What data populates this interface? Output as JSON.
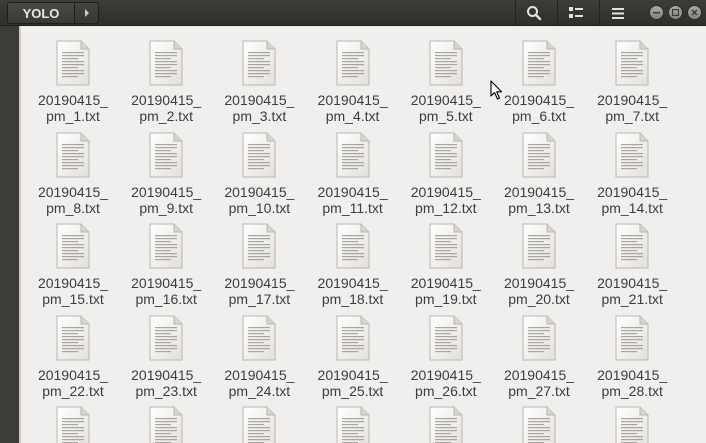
{
  "header": {
    "folder": "YOLO",
    "icons": [
      "chevron-right-icon",
      "search-icon",
      "view-toggle-icon",
      "menu-icon",
      "minimize-icon",
      "maximize-icon",
      "close-icon"
    ]
  },
  "files": [
    "20190415_\npm_1.txt",
    "20190415_\npm_2.txt",
    "20190415_\npm_3.txt",
    "20190415_\npm_4.txt",
    "20190415_\npm_5.txt",
    "20190415_\npm_6.txt",
    "20190415_\npm_7.txt",
    "20190415_\npm_8.txt",
    "20190415_\npm_9.txt",
    "20190415_\npm_10.txt",
    "20190415_\npm_11.txt",
    "20190415_\npm_12.txt",
    "20190415_\npm_13.txt",
    "20190415_\npm_14.txt",
    "20190415_\npm_15.txt",
    "20190415_\npm_16.txt",
    "20190415_\npm_17.txt",
    "20190415_\npm_18.txt",
    "20190415_\npm_19.txt",
    "20190415_\npm_20.txt",
    "20190415_\npm_21.txt",
    "20190415_\npm_22.txt",
    "20190415_\npm_23.txt",
    "20190415_\npm_24.txt",
    "20190415_\npm_25.txt",
    "20190415_\npm_26.txt",
    "20190415_\npm_27.txt",
    "20190415_\npm_28.txt"
  ],
  "partial_row_count": 7,
  "colors": {
    "header_bg": "#2f2e2b",
    "content_bg": "#f1efed",
    "label_text": "#3c3c3c"
  }
}
